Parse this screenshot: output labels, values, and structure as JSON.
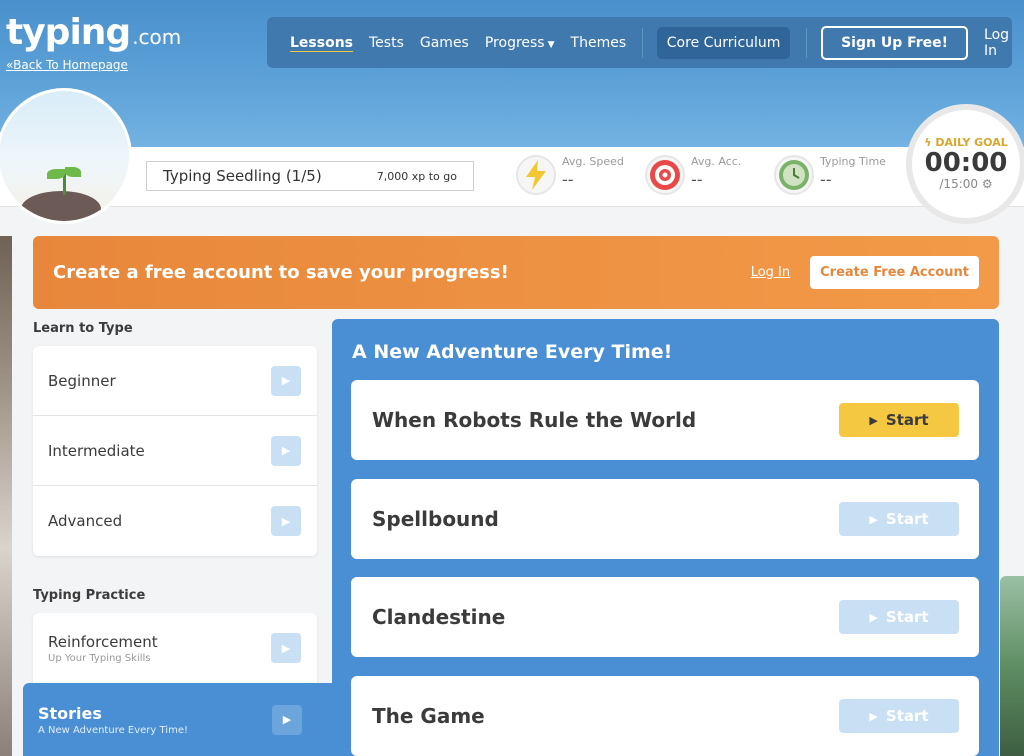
{
  "logo": {
    "name": "typing",
    "tld": ".com",
    "back_link": "«Back To Homepage"
  },
  "nav": {
    "lessons": "Lessons",
    "tests": "Tests",
    "games": "Games",
    "progress": "Progress",
    "themes": "Themes",
    "core": "Core Curriculum",
    "signup": "Sign Up Free!",
    "login": "Log In"
  },
  "level": {
    "name": "Typing Seedling (1/5)",
    "xp": "7,000 xp to go"
  },
  "stats": [
    {
      "label": "Avg. Speed",
      "value": "--",
      "icon": "lightning-icon"
    },
    {
      "label": "Avg. Acc.",
      "value": "--",
      "icon": "target-icon"
    },
    {
      "label": "Typing Time",
      "value": "--",
      "icon": "clock-icon"
    }
  ],
  "goal": {
    "label": "DAILY GOAL",
    "time": "00:00",
    "target": "/15:00"
  },
  "banner": {
    "text": "Create a free account to save your progress!",
    "login": "Log In",
    "create": "Create Free Account"
  },
  "learn": {
    "title": "Learn to Type",
    "items": [
      {
        "label": "Beginner"
      },
      {
        "label": "Intermediate"
      },
      {
        "label": "Advanced"
      }
    ]
  },
  "practice": {
    "title": "Typing Practice",
    "items": [
      {
        "label": "Reinforcement",
        "sub": "Up Your Typing Skills"
      },
      {
        "label": "Stories",
        "sub": "A New Adventure Every Time!"
      }
    ]
  },
  "panel": {
    "title": "A New Adventure Every Time!",
    "stories": [
      {
        "title": "When Robots Rule the World",
        "start": "Start"
      },
      {
        "title": "Spellbound",
        "start": "Start"
      },
      {
        "title": "Clandestine",
        "start": "Start"
      },
      {
        "title": "The Game",
        "start": "Start"
      }
    ]
  },
  "colors": {
    "accent": "#4a8fd3",
    "banner": "#e8873b",
    "start": "#f5c842"
  }
}
